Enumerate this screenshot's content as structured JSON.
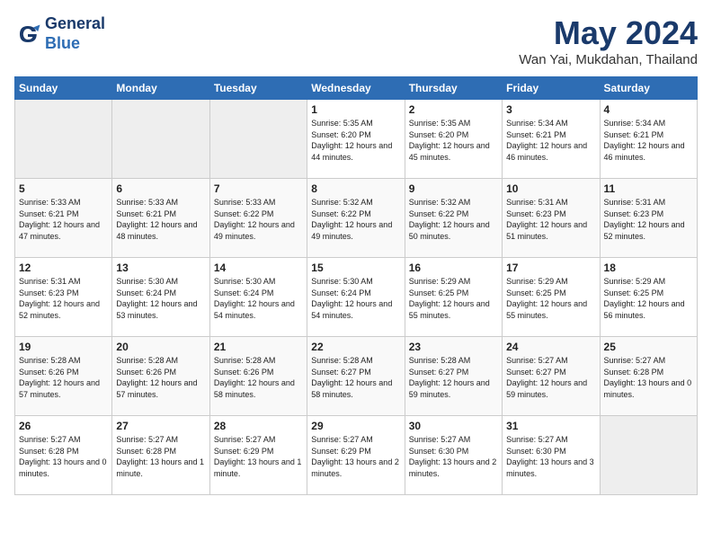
{
  "header": {
    "logo_line1": "General",
    "logo_line2": "Blue",
    "month_title": "May 2024",
    "location": "Wan Yai, Mukdahan, Thailand"
  },
  "days_of_week": [
    "Sunday",
    "Monday",
    "Tuesday",
    "Wednesday",
    "Thursday",
    "Friday",
    "Saturday"
  ],
  "weeks": [
    [
      {
        "day": "",
        "empty": true
      },
      {
        "day": "",
        "empty": true
      },
      {
        "day": "",
        "empty": true
      },
      {
        "day": "1",
        "sunrise": "Sunrise: 5:35 AM",
        "sunset": "Sunset: 6:20 PM",
        "daylight": "Daylight: 12 hours and 44 minutes."
      },
      {
        "day": "2",
        "sunrise": "Sunrise: 5:35 AM",
        "sunset": "Sunset: 6:20 PM",
        "daylight": "Daylight: 12 hours and 45 minutes."
      },
      {
        "day": "3",
        "sunrise": "Sunrise: 5:34 AM",
        "sunset": "Sunset: 6:21 PM",
        "daylight": "Daylight: 12 hours and 46 minutes."
      },
      {
        "day": "4",
        "sunrise": "Sunrise: 5:34 AM",
        "sunset": "Sunset: 6:21 PM",
        "daylight": "Daylight: 12 hours and 46 minutes."
      }
    ],
    [
      {
        "day": "5",
        "sunrise": "Sunrise: 5:33 AM",
        "sunset": "Sunset: 6:21 PM",
        "daylight": "Daylight: 12 hours and 47 minutes."
      },
      {
        "day": "6",
        "sunrise": "Sunrise: 5:33 AM",
        "sunset": "Sunset: 6:21 PM",
        "daylight": "Daylight: 12 hours and 48 minutes."
      },
      {
        "day": "7",
        "sunrise": "Sunrise: 5:33 AM",
        "sunset": "Sunset: 6:22 PM",
        "daylight": "Daylight: 12 hours and 49 minutes."
      },
      {
        "day": "8",
        "sunrise": "Sunrise: 5:32 AM",
        "sunset": "Sunset: 6:22 PM",
        "daylight": "Daylight: 12 hours and 49 minutes."
      },
      {
        "day": "9",
        "sunrise": "Sunrise: 5:32 AM",
        "sunset": "Sunset: 6:22 PM",
        "daylight": "Daylight: 12 hours and 50 minutes."
      },
      {
        "day": "10",
        "sunrise": "Sunrise: 5:31 AM",
        "sunset": "Sunset: 6:23 PM",
        "daylight": "Daylight: 12 hours and 51 minutes."
      },
      {
        "day": "11",
        "sunrise": "Sunrise: 5:31 AM",
        "sunset": "Sunset: 6:23 PM",
        "daylight": "Daylight: 12 hours and 52 minutes."
      }
    ],
    [
      {
        "day": "12",
        "sunrise": "Sunrise: 5:31 AM",
        "sunset": "Sunset: 6:23 PM",
        "daylight": "Daylight: 12 hours and 52 minutes."
      },
      {
        "day": "13",
        "sunrise": "Sunrise: 5:30 AM",
        "sunset": "Sunset: 6:24 PM",
        "daylight": "Daylight: 12 hours and 53 minutes."
      },
      {
        "day": "14",
        "sunrise": "Sunrise: 5:30 AM",
        "sunset": "Sunset: 6:24 PM",
        "daylight": "Daylight: 12 hours and 54 minutes."
      },
      {
        "day": "15",
        "sunrise": "Sunrise: 5:30 AM",
        "sunset": "Sunset: 6:24 PM",
        "daylight": "Daylight: 12 hours and 54 minutes."
      },
      {
        "day": "16",
        "sunrise": "Sunrise: 5:29 AM",
        "sunset": "Sunset: 6:25 PM",
        "daylight": "Daylight: 12 hours and 55 minutes."
      },
      {
        "day": "17",
        "sunrise": "Sunrise: 5:29 AM",
        "sunset": "Sunset: 6:25 PM",
        "daylight": "Daylight: 12 hours and 55 minutes."
      },
      {
        "day": "18",
        "sunrise": "Sunrise: 5:29 AM",
        "sunset": "Sunset: 6:25 PM",
        "daylight": "Daylight: 12 hours and 56 minutes."
      }
    ],
    [
      {
        "day": "19",
        "sunrise": "Sunrise: 5:28 AM",
        "sunset": "Sunset: 6:26 PM",
        "daylight": "Daylight: 12 hours and 57 minutes."
      },
      {
        "day": "20",
        "sunrise": "Sunrise: 5:28 AM",
        "sunset": "Sunset: 6:26 PM",
        "daylight": "Daylight: 12 hours and 57 minutes."
      },
      {
        "day": "21",
        "sunrise": "Sunrise: 5:28 AM",
        "sunset": "Sunset: 6:26 PM",
        "daylight": "Daylight: 12 hours and 58 minutes."
      },
      {
        "day": "22",
        "sunrise": "Sunrise: 5:28 AM",
        "sunset": "Sunset: 6:27 PM",
        "daylight": "Daylight: 12 hours and 58 minutes."
      },
      {
        "day": "23",
        "sunrise": "Sunrise: 5:28 AM",
        "sunset": "Sunset: 6:27 PM",
        "daylight": "Daylight: 12 hours and 59 minutes."
      },
      {
        "day": "24",
        "sunrise": "Sunrise: 5:27 AM",
        "sunset": "Sunset: 6:27 PM",
        "daylight": "Daylight: 12 hours and 59 minutes."
      },
      {
        "day": "25",
        "sunrise": "Sunrise: 5:27 AM",
        "sunset": "Sunset: 6:28 PM",
        "daylight": "Daylight: 13 hours and 0 minutes."
      }
    ],
    [
      {
        "day": "26",
        "sunrise": "Sunrise: 5:27 AM",
        "sunset": "Sunset: 6:28 PM",
        "daylight": "Daylight: 13 hours and 0 minutes."
      },
      {
        "day": "27",
        "sunrise": "Sunrise: 5:27 AM",
        "sunset": "Sunset: 6:28 PM",
        "daylight": "Daylight: 13 hours and 1 minute."
      },
      {
        "day": "28",
        "sunrise": "Sunrise: 5:27 AM",
        "sunset": "Sunset: 6:29 PM",
        "daylight": "Daylight: 13 hours and 1 minute."
      },
      {
        "day": "29",
        "sunrise": "Sunrise: 5:27 AM",
        "sunset": "Sunset: 6:29 PM",
        "daylight": "Daylight: 13 hours and 2 minutes."
      },
      {
        "day": "30",
        "sunrise": "Sunrise: 5:27 AM",
        "sunset": "Sunset: 6:30 PM",
        "daylight": "Daylight: 13 hours and 2 minutes."
      },
      {
        "day": "31",
        "sunrise": "Sunrise: 5:27 AM",
        "sunset": "Sunset: 6:30 PM",
        "daylight": "Daylight: 13 hours and 3 minutes."
      },
      {
        "day": "",
        "empty": true
      }
    ]
  ]
}
